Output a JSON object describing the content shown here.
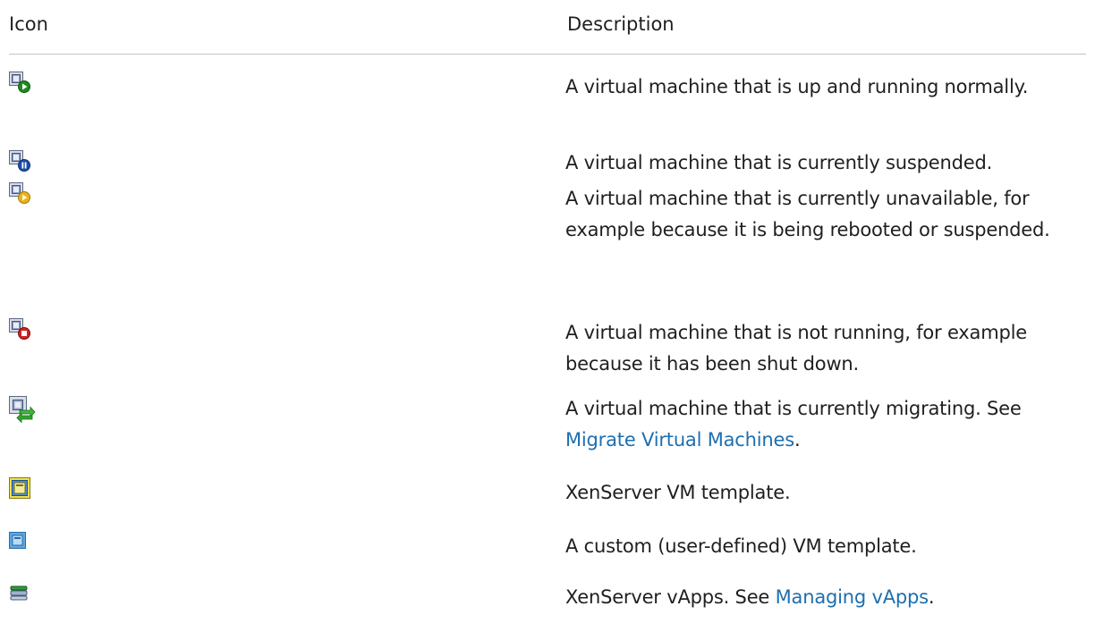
{
  "header": {
    "icon_col": "Icon",
    "description_col": "Description"
  },
  "rows": [
    {
      "icon": "vm-running-icon",
      "text": "A virtual machine that is up and running normally."
    },
    {
      "icon": "vm-suspended-icon",
      "text": "A virtual machine that is currently suspended."
    },
    {
      "icon": "vm-unavailable-icon",
      "text": "A virtual machine that is currently unavailable, for example because it is being rebooted or suspended."
    },
    {
      "icon": "vm-stopped-icon",
      "text": "A virtual machine that is not running, for example because it has been shut down."
    },
    {
      "icon": "vm-migrating-icon",
      "text": "A virtual machine that is currently migrating. See",
      "link": "Migrate Virtual Machines",
      "suffix": "."
    },
    {
      "icon": "xenserver-template-icon",
      "text": "XenServer VM template."
    },
    {
      "icon": "custom-template-icon",
      "text": "A custom (user-defined) VM template."
    },
    {
      "icon": "vapp-icon",
      "text": "XenServer vApps. See",
      "link": "Managing vApps",
      "suffix": "."
    }
  ]
}
